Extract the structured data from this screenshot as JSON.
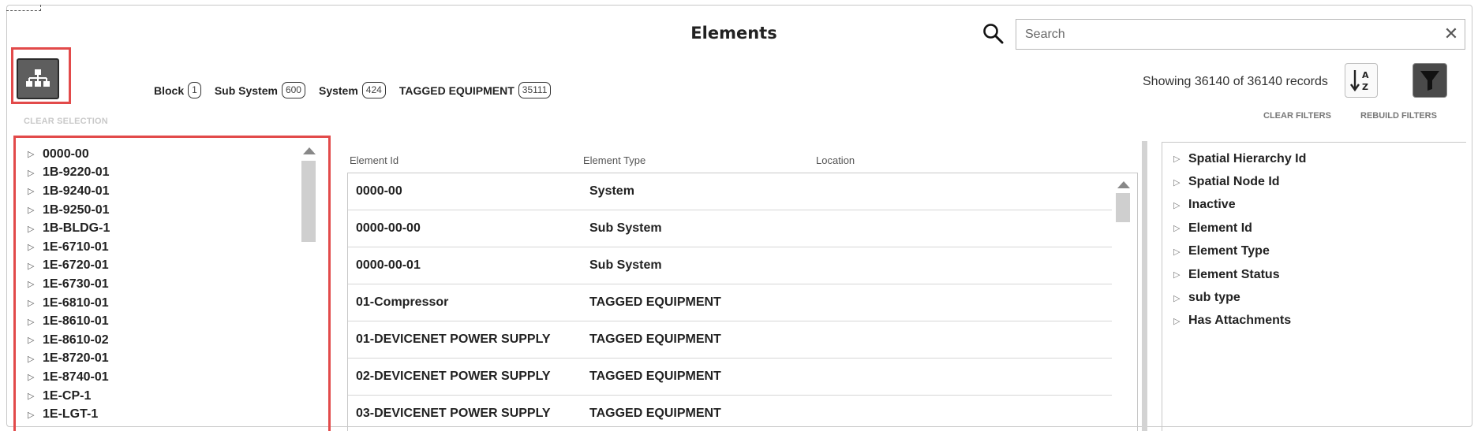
{
  "header": {
    "title": "Elements",
    "search_placeholder": "Search",
    "clear_search": "✕"
  },
  "toolbar": {
    "clear_selection": "CLEAR SELECTION",
    "records_text": "Showing 36140 of 36140 records",
    "clear_filters": "CLEAR FILTERS",
    "rebuild_filters": "REBUILD FILTERS"
  },
  "chips": [
    {
      "label": "Block",
      "count": "1"
    },
    {
      "label": "Sub System",
      "count": "600"
    },
    {
      "label": "System",
      "count": "424"
    },
    {
      "label": "TAGGED EQUIPMENT",
      "count": "35111"
    }
  ],
  "tree": {
    "items": [
      "0000-00",
      "1B-9220-01",
      "1B-9240-01",
      "1B-9250-01",
      "1B-BLDG-1",
      "1E-6710-01",
      "1E-6720-01",
      "1E-6730-01",
      "1E-6810-01",
      "1E-8610-01",
      "1E-8610-02",
      "1E-8720-01",
      "1E-8740-01",
      "1E-CP-1",
      "1E-LGT-1"
    ]
  },
  "grid": {
    "columns": [
      "Element Id",
      "Element Type",
      "Location"
    ],
    "rows": [
      {
        "id": "0000-00",
        "type": "System"
      },
      {
        "id": "0000-00-00",
        "type": "Sub System"
      },
      {
        "id": "0000-00-01",
        "type": "Sub System"
      },
      {
        "id": "01-Compressor",
        "type": "TAGGED EQUIPMENT"
      },
      {
        "id": "01-DEVICENET POWER SUPPLY",
        "type": "TAGGED EQUIPMENT"
      },
      {
        "id": "02-DEVICENET POWER SUPPLY",
        "type": "TAGGED EQUIPMENT"
      },
      {
        "id": "03-DEVICENET POWER SUPPLY",
        "type": "TAGGED EQUIPMENT"
      }
    ]
  },
  "filters": {
    "items": [
      "Spatial Hierarchy Id",
      "Spatial Node Id",
      "Inactive",
      "Element Id",
      "Element Type",
      "Element Status",
      "sub type",
      "Has Attachments"
    ]
  },
  "colors": {
    "highlight": "#e24a4a",
    "button_dark": "#5e5e5e"
  }
}
